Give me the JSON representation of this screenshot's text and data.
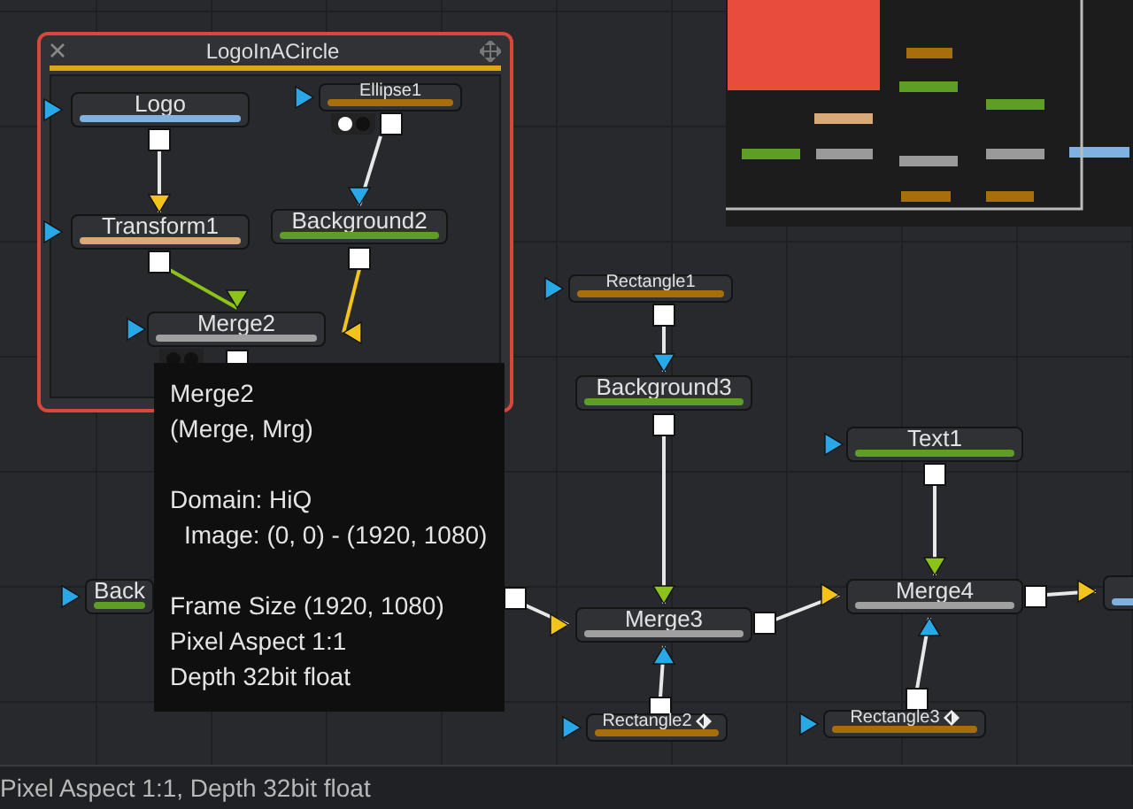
{
  "group": {
    "title": "LogoInACircle",
    "nodes": [
      {
        "label": "Logo",
        "color": "#7fb2e0",
        "kind": "normal"
      },
      {
        "label": "Ellipse1",
        "color": "#a86e0c",
        "kind": "small",
        "viewers": [
          true,
          false
        ]
      },
      {
        "label": "Transform1",
        "color": "#d9a97a",
        "kind": "normal"
      },
      {
        "label": "Background2",
        "color": "#5f9e26",
        "kind": "normal"
      },
      {
        "label": "Merge2",
        "color": "#a0a0a0",
        "kind": "normal",
        "viewers": [
          false,
          false
        ]
      }
    ]
  },
  "nodes": [
    {
      "label": "Back",
      "color": "#5f9e26",
      "kind": "normal"
    },
    {
      "label": "Rectangle1",
      "color": "#a86e0c",
      "kind": "small"
    },
    {
      "label": "Background3",
      "color": "#5f9e26",
      "kind": "normal"
    },
    {
      "label": "Text1",
      "color": "#5f9e26",
      "kind": "normal"
    },
    {
      "label": "Merge3",
      "color": "#a0a0a0",
      "kind": "normal"
    },
    {
      "label": "Merge4",
      "color": "#a0a0a0",
      "kind": "normal"
    },
    {
      "label": "Rectangle2",
      "color": "#a86e0c",
      "kind": "small",
      "keyframed": true
    },
    {
      "label": "Rectangle3",
      "color": "#a86e0c",
      "kind": "small",
      "keyframed": true
    },
    {
      "color": "#7fb2e0",
      "kind": "normal"
    }
  ],
  "tooltip": {
    "blocks": [
      [
        {
          "text": "Merge2",
          "indent": false
        },
        {
          "text": "(Merge, Mrg)",
          "indent": false
        }
      ],
      [
        {
          "text": "Domain: HiQ",
          "indent": false
        },
        {
          "text": "Image: (0, 0) - (1920, 1080)",
          "indent": true
        }
      ],
      [
        {
          "text": "Frame Size (1920, 1080)",
          "indent": false
        },
        {
          "text": "Pixel Aspect 1:1",
          "indent": false
        },
        {
          "text": "Depth 32bit float",
          "indent": false
        }
      ]
    ]
  },
  "status_bar": {
    "text": "Pixel Aspect 1:1, Depth 32bit float"
  }
}
